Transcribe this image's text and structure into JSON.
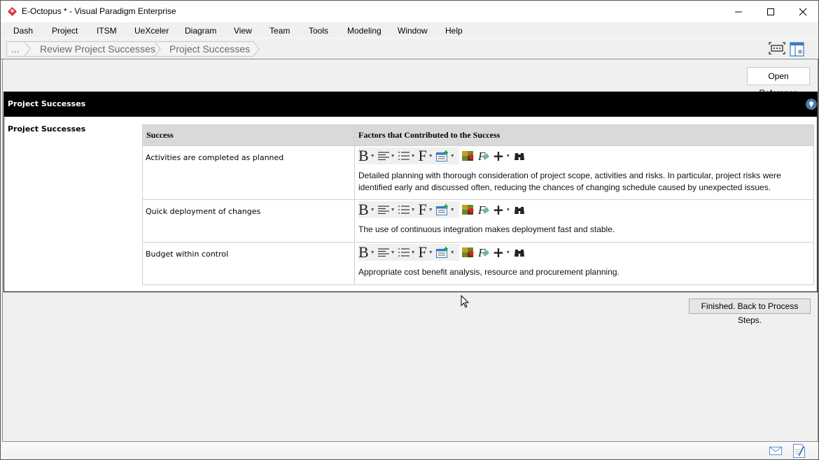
{
  "window": {
    "title": "E-Octopus * - Visual Paradigm Enterprise",
    "controls": [
      "minimize",
      "maximize",
      "close"
    ]
  },
  "menu": {
    "items": [
      "Dash",
      "Project",
      "ITSM",
      "UeXceler",
      "Diagram",
      "View",
      "Team",
      "Tools",
      "Modeling",
      "Window",
      "Help"
    ]
  },
  "breadcrumb": {
    "items": [
      "...",
      "Review Project Successes",
      "Project Successes"
    ]
  },
  "toolbar_icons": [
    "fit-diagram-icon",
    "panel-layout-icon"
  ],
  "content": {
    "open_reference_label": "Open Reference",
    "panel_title": "Project Successes",
    "side_label": "Project Successes",
    "table": {
      "headers": [
        "Success",
        "Factors that Contributed to the Success"
      ],
      "rows": [
        {
          "success": "Activities are completed as planned",
          "factors": "Detailed planning with thorough consideration of project scope, activities and risks. In particular, project risks were identified early and discussed often, reducing the chances of changing schedule caused by unexpected issues."
        },
        {
          "success": "Quick deployment of changes",
          "factors": "The use of continuous integration makes deployment fast and stable."
        },
        {
          "success": "Budget within control",
          "factors": "Appropriate cost benefit analysis, resource and procurement planning."
        }
      ]
    },
    "editor_toolbar": {
      "bold_glyph": "B",
      "font_glyph": "F",
      "formula_glyph": "F",
      "insert_glyph": "+"
    },
    "finish_label": "Finished. Back to Process Steps."
  },
  "statusbar": {
    "icons": [
      "mail-icon",
      "notes-icon"
    ]
  },
  "colors": {
    "panel_header_bg": "#000000",
    "panel_header_text": "#ffffff",
    "table_header_bg": "#d9d9d9",
    "app_accent": "#d9343a",
    "pin_icon_bg": "#4d7aa6"
  }
}
